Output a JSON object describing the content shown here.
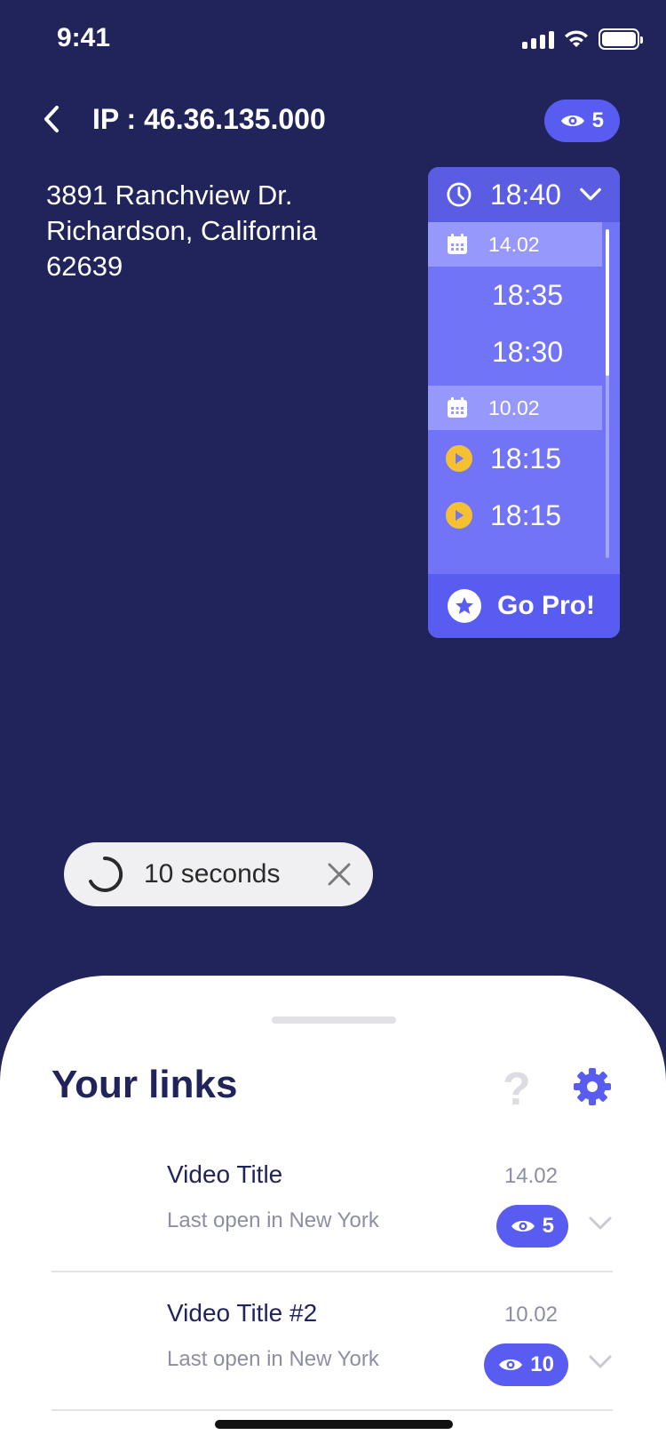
{
  "status_bar": {
    "time": "9:41"
  },
  "header": {
    "title": "IP : 46.36.135.000",
    "views": "5"
  },
  "address": {
    "line1": "3891 Ranchview Dr.",
    "line2": "Richardson, California",
    "line3": "62639"
  },
  "time_panel": {
    "selected_time": "18:40",
    "groups": [
      {
        "date": "14.02",
        "times": [
          "18:35",
          "18:30"
        ]
      },
      {
        "date": "10.02",
        "times": [
          "18:15",
          "18:15"
        ]
      }
    ],
    "go_pro_label": "Go Pro!"
  },
  "timer": {
    "label": "10 seconds"
  },
  "sheet": {
    "title": "Your links",
    "help_symbol": "?",
    "links": [
      {
        "title": "Video Title",
        "subtitle": "Last open in New York",
        "date": "14.02",
        "views": "5"
      },
      {
        "title": "Video Title #2",
        "subtitle": "Last open in New York",
        "date": "10.02",
        "views": "10"
      }
    ]
  },
  "colors": {
    "background": "#20245b",
    "accent": "#595cf0",
    "panel": "#7274f7",
    "play_icon": "#f6c033"
  }
}
